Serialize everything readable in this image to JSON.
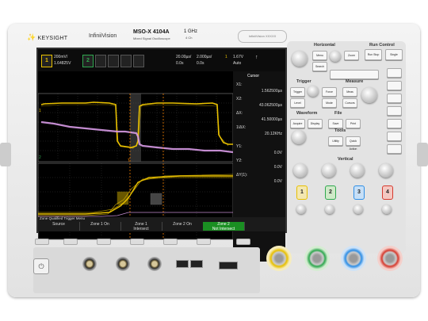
{
  "header": {
    "brand": "KEYSIGHT",
    "series": "InfiniiVision",
    "model": "MSO-X 4104A",
    "model_sub": "Mixed Signal Oscilloscope",
    "bandwidth": "1 GHz",
    "channels_label": "4 Ch",
    "brand_strip": "InfiniiVision XXXXX"
  },
  "scope": {
    "status": {
      "ch1_label": "1",
      "ch1_scale": "200mV/",
      "ch1_offset": "1.64825V",
      "ch2_label": "2",
      "time_scale": "20.00µs/",
      "time_delay": "0.0s",
      "zoom_scale": "2.000µs/",
      "zoom_delay": "0.0s",
      "trigger_chan": "1",
      "trigger_level": "1.67V",
      "trigger_mode": "Auto"
    },
    "side": {
      "title": "Cursor",
      "x1_label": "X1:",
      "x1_value": "1.562500µs",
      "x2_label": "X2:",
      "x2_value": "43.062500µs",
      "dx_label": "ΔX:",
      "dx_value": "41.50000µs",
      "inv_dx_label": "1/ΔX:",
      "inv_dx_value": "20.12KHz",
      "y1_label": "Y1:",
      "y1_value": "0.0V",
      "y2_label": "Y2:",
      "y2_value": "0.0V",
      "dy_label": "ΔY(1):",
      "dy_value": "0.0V"
    },
    "menu": {
      "title": "Zone Qualified Trigger Menu",
      "softkeys": [
        {
          "label": "Source",
          "sub": "",
          "active": false
        },
        {
          "label": "Zone 1 On",
          "sub": "",
          "active": false
        },
        {
          "label": "Zone 1",
          "sub": "Intersect",
          "active": false
        },
        {
          "label": "Zone 2 On",
          "sub": "",
          "active": false
        },
        {
          "label": "Zone 2",
          "sub": "Not Intersect",
          "active": true
        }
      ]
    }
  },
  "panel": {
    "horizontal": "Horizontal",
    "run_control": "Run Control",
    "run_stop": "Run Stop",
    "single": "Single",
    "trigger": "Trigger",
    "measure": "Measure",
    "waveform": "Waveform",
    "file": "File",
    "tools": "Tools",
    "vertical": "Vertical",
    "buttons": {
      "menu": "Menu",
      "search": "Search",
      "zoom": "Zoom",
      "trig_menu": "Trigger",
      "level": "Level",
      "force": "Force",
      "mode": "Mode",
      "meas": "Meas",
      "cursors": "Cursors",
      "acquire": "Acquire",
      "display": "Display",
      "save": "Save",
      "print": "Print",
      "utility": "Utility",
      "quick_action": "Quick Action",
      "digital": "Digital",
      "math": "Math",
      "ref": "Ref"
    }
  },
  "inputs": {
    "ch1": "1",
    "ch2": "2",
    "ch3": "3",
    "ch4": "4",
    "colors": {
      "ch1": "#e8c000",
      "ch2": "#2fa84f",
      "ch3": "#2d8ee6",
      "ch4": "#d63a2e"
    }
  },
  "waveform_colors": {
    "ch1": "#e8c000",
    "ch2": "#d79ae6",
    "cursor": "#f07c00"
  }
}
